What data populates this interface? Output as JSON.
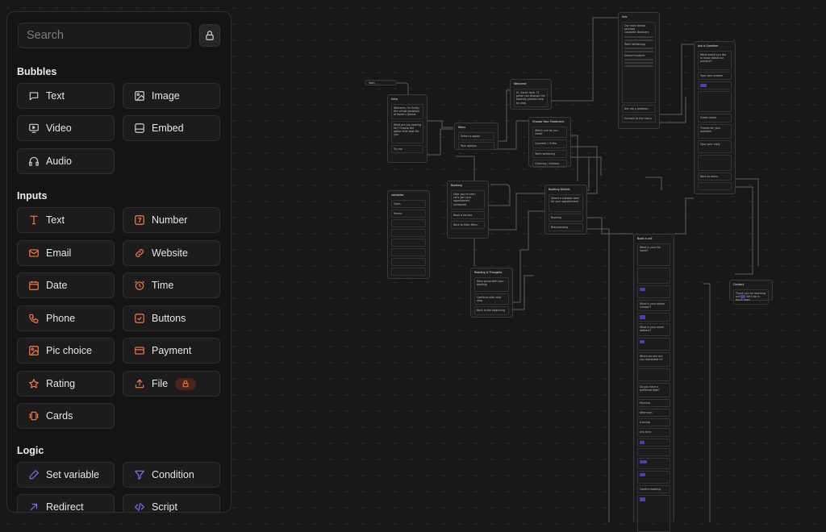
{
  "sidebar": {
    "search": {
      "placeholder": "Search"
    },
    "sections": {
      "bubbles": {
        "title": "Bubbles",
        "items": [
          {
            "label": "Text",
            "icon": "message-icon"
          },
          {
            "label": "Image",
            "icon": "image-icon"
          },
          {
            "label": "Video",
            "icon": "video-icon"
          },
          {
            "label": "Embed",
            "icon": "embed-icon"
          },
          {
            "label": "Audio",
            "icon": "headphones-icon"
          }
        ]
      },
      "inputs": {
        "title": "Inputs",
        "items": [
          {
            "label": "Text",
            "icon": "text-cursor-icon"
          },
          {
            "label": "Number",
            "icon": "number-icon"
          },
          {
            "label": "Email",
            "icon": "mail-icon"
          },
          {
            "label": "Website",
            "icon": "link-icon"
          },
          {
            "label": "Date",
            "icon": "calendar-icon"
          },
          {
            "label": "Time",
            "icon": "clock-icon"
          },
          {
            "label": "Phone",
            "icon": "phone-icon"
          },
          {
            "label": "Buttons",
            "icon": "checkbox-icon"
          },
          {
            "label": "Pic choice",
            "icon": "image-icon"
          },
          {
            "label": "Payment",
            "icon": "credit-card-icon"
          },
          {
            "label": "Rating",
            "icon": "star-icon"
          },
          {
            "label": "File",
            "icon": "upload-icon",
            "locked": true
          },
          {
            "label": "Cards",
            "icon": "cards-icon"
          }
        ]
      },
      "logic": {
        "title": "Logic",
        "items": [
          {
            "label": "Set variable",
            "icon": "pen-icon"
          },
          {
            "label": "Condition",
            "icon": "filter-icon"
          },
          {
            "label": "Redirect",
            "icon": "arrow-up-right-icon"
          },
          {
            "label": "Script",
            "icon": "code-icon"
          }
        ]
      }
    }
  },
  "colors": {
    "bubble_icon": "#d0d0d0",
    "input_icon": "#ff7a45",
    "logic_icon": "#8c6cff",
    "tag": "#4e3fb4"
  },
  "canvas": {
    "start_label": "Start",
    "blocks": {
      "intro": {
        "title": "Intro",
        "lines": [
          "Welcome, I'm Emily, the virtual assistant of Sarah's Dental",
          "What are you looking for? Choose the option that best fits you",
          "Try me"
        ]
      },
      "menu": {
        "title": "Menu",
        "lines": [
          "Select a option",
          "Your options"
        ]
      },
      "variables": {
        "title": "variables",
        "items": [
          "Sighs",
          "Emma"
        ]
      },
      "booking": {
        "title": "Booking",
        "lines": [
          "Glad you're here! Let's get your appointment scheduled",
          "Book a service",
          "Back to Main Menu"
        ]
      },
      "welcome": {
        "title": "Welcome",
        "lines": [
          "Hi, Sarah here, I'll guide you through the booking process step by step.",
          "Ask a question"
        ]
      },
      "choose_treatment": {
        "title": "Choose Your Treatment",
        "options": [
          "Which one do you need?",
          "Cosmetic / Ortho",
          "Teeth whitening",
          "Cleaning / checkup",
          "Emergency"
        ]
      },
      "appointment": {
        "title": "Booking Details",
        "lines": [
          "Select a suitable date for your appointment",
          "Booking",
          "Rescheduling"
        ]
      },
      "reading": {
        "title": "Reading & Thoughts",
        "lines": [
          "Keep going with your booking",
          "Continue with next step",
          "Back to the beginning"
        ]
      },
      "info": {
        "title": "Info",
        "lines": [
          "Our main dental services",
          "Cosmetic Dentistry",
          "Teeth Whitening",
          "Dental Implants",
          "Ask me a question",
          "Go back to the menu"
        ]
      },
      "faq": {
        "title": "Ask a Question",
        "lines": [
          "What would you like to know about our practice?",
          "Type your answer",
          "Great choice",
          "Thanks for your question",
          "Type your reply",
          "Back to menu"
        ]
      },
      "booking_form": {
        "title": "Book a call",
        "lines": [
          "What is your full name?",
          "What is your phone number?",
          "What is your email address?",
          "Which service are you interested in?",
          "Do you have a preferred date?",
          "Morning",
          "Afternoon",
          "Evening",
          "Any time",
          "Confirm booking"
        ]
      },
      "contact": {
        "title": "Contact",
        "lines": [
          "Thank you for reaching out",
          "We'll be in touch soon"
        ]
      }
    }
  }
}
